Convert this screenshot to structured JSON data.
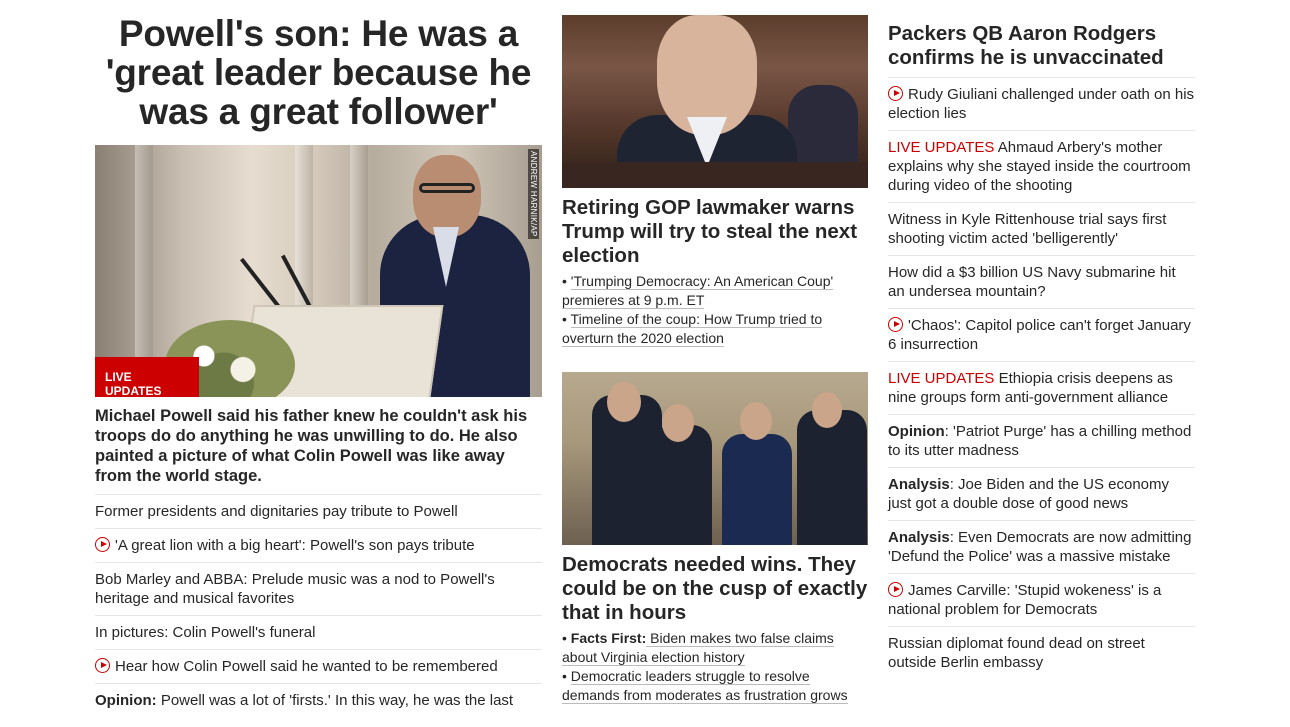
{
  "lead": {
    "headline": "Powell's son: He was a 'great leader because he was a great follower'",
    "image_credit": "ANDREW HARNIK/AP",
    "badge": "LIVE UPDATES",
    "summary": "Michael Powell said his father knew he couldn't ask his troops do do anything he was unwilling to do. He also painted a picture of what Colin Powell was like away from the world stage.",
    "items": [
      {
        "prefix": "",
        "text": "Former presidents and dignitaries pay tribute to Powell",
        "video": false
      },
      {
        "prefix": "",
        "text": "'A great lion with a big heart': Powell's son pays tribute",
        "video": true
      },
      {
        "prefix": "",
        "text": "Bob Marley and ABBA: Prelude music was a nod to Powell's heritage and musical favorites",
        "video": false
      },
      {
        "prefix": "",
        "text": "In pictures: Colin Powell's funeral",
        "video": false
      },
      {
        "prefix": "",
        "text": "Hear how Colin Powell said he wanted to be remembered",
        "video": true
      },
      {
        "prefix": "Opinion:",
        "text": " Powell was a lot of 'firsts.' In this way, he was the last",
        "video": false
      }
    ]
  },
  "middle": {
    "story1": {
      "headline": "Retiring GOP lawmaker warns Trump will try to steal the next election",
      "links": [
        {
          "bullet": "• ",
          "bold": "",
          "text": "'Trumping Democracy: An American Coup' premieres at 9 p.m. ET"
        },
        {
          "bullet": "• ",
          "bold": "",
          "text": "Timeline of the coup: How Trump tried to overturn the 2020 election"
        }
      ]
    },
    "story2": {
      "headline": "Democrats needed wins. They could be on the cusp of exactly that in hours",
      "links": [
        {
          "bullet": "• ",
          "bold": "Facts First:",
          "text": " Biden makes two false claims about Virginia election history"
        },
        {
          "bullet": "• ",
          "bold": "",
          "text": "Democratic leaders struggle to resolve demands from moderates as frustration grows"
        }
      ]
    }
  },
  "right": {
    "headline": "Packers QB Aaron Rodgers confirms he is unvaccinated",
    "items": [
      {
        "tag": "",
        "tag_type": "",
        "text": "Rudy Giuliani challenged under oath on his election lies",
        "video": true
      },
      {
        "tag": "LIVE UPDATES",
        "tag_type": "live",
        "text": " Ahmaud Arbery's mother explains why she stayed inside the courtroom during video of the shooting",
        "video": false
      },
      {
        "tag": "",
        "tag_type": "",
        "text": "Witness in Kyle Rittenhouse trial says first shooting victim acted 'belligerently'",
        "video": false
      },
      {
        "tag": "",
        "tag_type": "",
        "text": "How did a $3 billion US Navy submarine hit an undersea mountain?",
        "video": false
      },
      {
        "tag": "",
        "tag_type": "",
        "text": "'Chaos': Capitol police can't forget January 6 insurrection",
        "video": true
      },
      {
        "tag": "LIVE UPDATES",
        "tag_type": "live",
        "text": " Ethiopia crisis deepens as nine groups form anti-government alliance",
        "video": false
      },
      {
        "tag": "Opinion",
        "tag_type": "bold",
        "text": ": 'Patriot Purge' has a chilling method to its utter madness",
        "video": false
      },
      {
        "tag": "Analysis",
        "tag_type": "bold",
        "text": ": Joe Biden and the US economy just got a double dose of good news",
        "video": false
      },
      {
        "tag": "Analysis",
        "tag_type": "bold",
        "text": ": Even Democrats are now admitting 'Defund the Police' was a massive mistake",
        "video": false
      },
      {
        "tag": "",
        "tag_type": "",
        "text": "James Carville: 'Stupid wokeness' is a national problem for Democrats",
        "video": true
      },
      {
        "tag": "",
        "tag_type": "",
        "text": "Russian diplomat found dead on street outside Berlin embassy",
        "video": false
      }
    ]
  },
  "colors": {
    "accent_red": "#cc0000",
    "text": "#262626",
    "divider": "#e5e5e5"
  }
}
